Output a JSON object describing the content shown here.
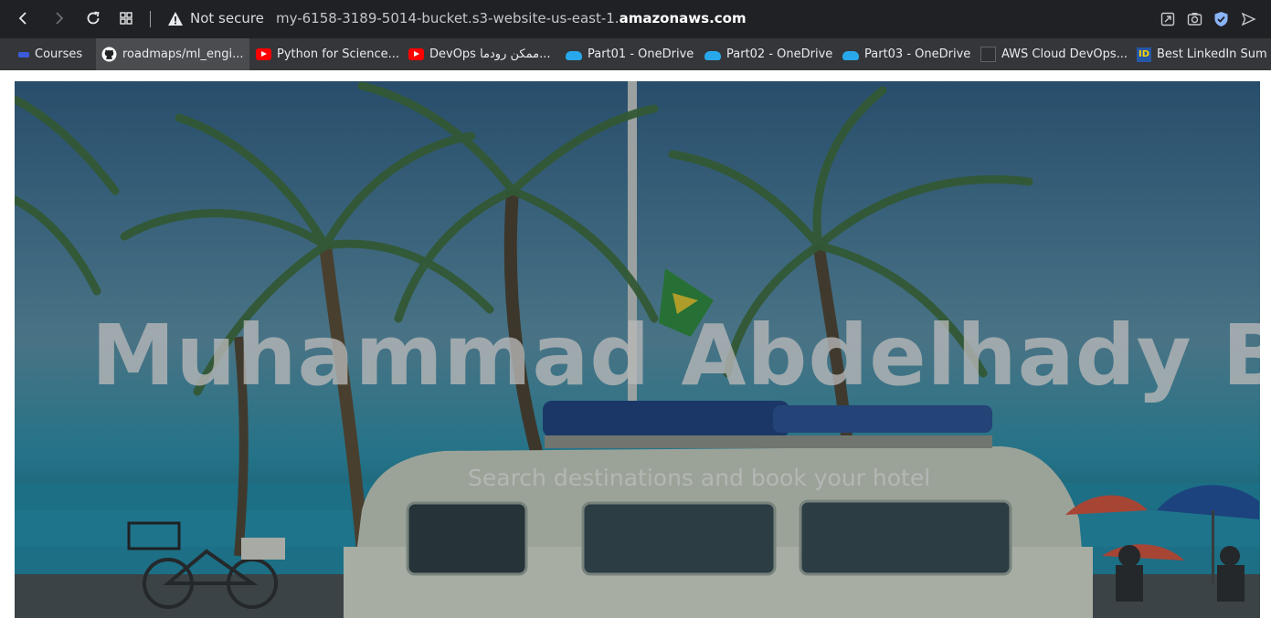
{
  "browser": {
    "security_label": "Not secure",
    "url_prefix": "my-6158-3189-5014-bucket.s3-website-us-east-1.",
    "url_domain": "amazonaws.com"
  },
  "bookmarks": [
    {
      "label": "Courses",
      "icon": "courses-icon"
    },
    {
      "label": "roadmaps/ml_engi...",
      "icon": "github-icon"
    },
    {
      "label": "Python for Science...",
      "icon": "youtube-icon"
    },
    {
      "label": "DevOps ممكن رودما...",
      "icon": "youtube-icon"
    },
    {
      "label": "Part01 - OneDrive",
      "icon": "onedrive-icon"
    },
    {
      "label": "Part02 - OneDrive",
      "icon": "onedrive-icon"
    },
    {
      "label": "Part03 - OneDrive",
      "icon": "onedrive-icon"
    },
    {
      "label": "AWS Cloud DevOps...",
      "icon": "aws-icon"
    },
    {
      "label": "Best LinkedIn Sum",
      "icon": "indeed-icon"
    }
  ],
  "hero": {
    "title": "Muhammad Abdelhady Blog",
    "subtitle": "Search destinations and book your hotel"
  },
  "colors": {
    "toolbar_bg": "#202124",
    "bookmarks_bg": "#35363a",
    "shield_accent": "#8ab4f8"
  }
}
